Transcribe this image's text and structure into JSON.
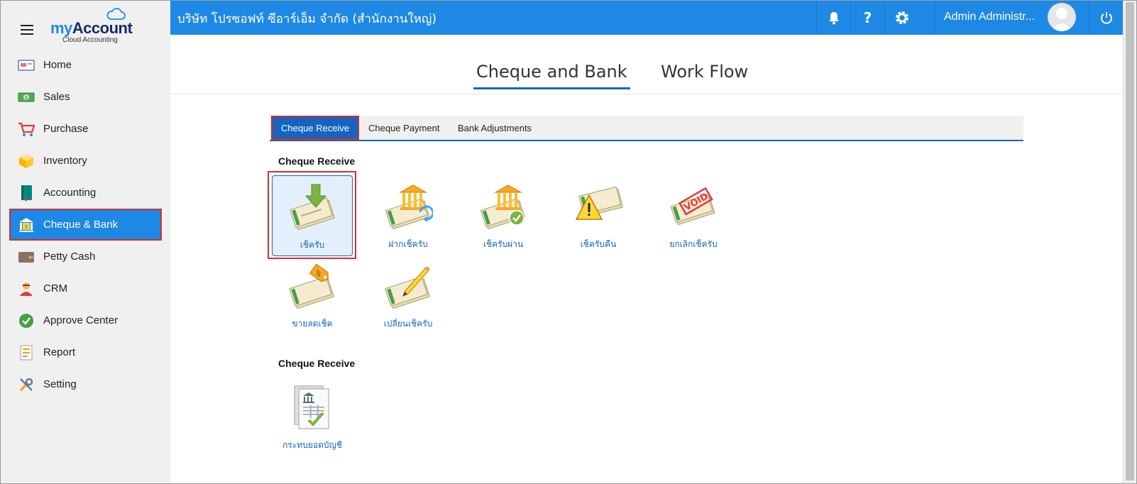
{
  "app": {
    "logo_prefix": "my",
    "logo_name": "Account",
    "logo_subtitle": "Cloud Accounting",
    "company_name": "บริษัท โปรซอฟท์ ซีอาร์เอ็ม จำกัด (สำนักงานใหญ่)",
    "user_name": "Admin Administr...",
    "accent_color": "#1e88e5",
    "highlight_color": "#d32f2f"
  },
  "sidebar": {
    "items": [
      {
        "label": "Home",
        "icon": "home-icon"
      },
      {
        "label": "Sales",
        "icon": "sales-icon"
      },
      {
        "label": "Purchase",
        "icon": "cart-icon"
      },
      {
        "label": "Inventory",
        "icon": "box-icon"
      },
      {
        "label": "Accounting",
        "icon": "book-icon"
      },
      {
        "label": "Cheque & Bank",
        "icon": "bank-icon"
      },
      {
        "label": "Petty Cash",
        "icon": "wallet-icon"
      },
      {
        "label": "CRM",
        "icon": "people-icon"
      },
      {
        "label": "Approve Center",
        "icon": "check-circle-icon"
      },
      {
        "label": "Report",
        "icon": "report-icon"
      },
      {
        "label": "Setting",
        "icon": "tools-icon"
      }
    ],
    "active_item": "Cheque & Bank"
  },
  "main_tabs": [
    {
      "label": "Cheque and Bank",
      "active": true
    },
    {
      "label": "Work Flow",
      "active": false
    }
  ],
  "sub_tabs": [
    {
      "label": "Cheque Receive",
      "active": true
    },
    {
      "label": "Cheque Payment",
      "active": false
    },
    {
      "label": "Bank Adjustments",
      "active": false
    }
  ],
  "sections": [
    {
      "title": "Cheque Receive",
      "tiles": [
        {
          "label": "เช็ครับ",
          "icon": "cheque-receive-icon"
        },
        {
          "label": "ฝากเช็ครับ",
          "icon": "cheque-deposit-icon"
        },
        {
          "label": "เช็ครับผ่าน",
          "icon": "cheque-passed-icon"
        },
        {
          "label": "เช็ครับคืน",
          "icon": "cheque-returned-icon"
        },
        {
          "label": "ยกเลิกเช็ครับ",
          "icon": "cheque-void-icon"
        },
        {
          "label": "ขายลดเช็ค",
          "icon": "cheque-discount-icon"
        },
        {
          "label": "เปลี่ยนเช็ครับ",
          "icon": "cheque-change-icon"
        }
      ]
    },
    {
      "title": "Cheque Receive",
      "tiles": [
        {
          "label": "กระทบยอดบัญชี",
          "icon": "bank-reconcile-icon"
        }
      ]
    }
  ],
  "void_stamp_text": "VOID"
}
